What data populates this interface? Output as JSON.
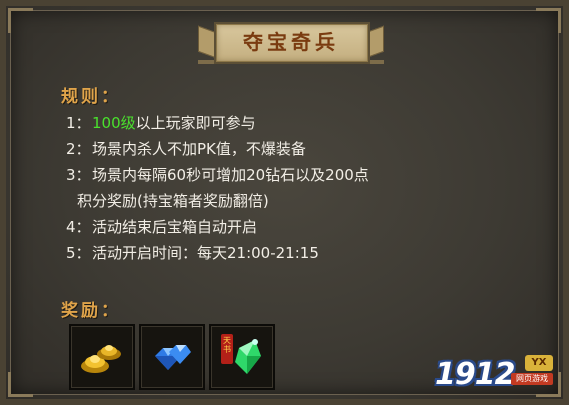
{
  "banner": {
    "title": "夺宝奇兵"
  },
  "rules_section": {
    "heading": "规则：",
    "items": [
      {
        "num": "1：",
        "highlight": "100级",
        "text": "以上玩家即可参与"
      },
      {
        "num": "2：",
        "text": "场景内杀人不加PK值，不爆装备"
      },
      {
        "num": "3：",
        "text": "场景内每隔60秒可增加20钻石以及200点"
      },
      {
        "continuation": "积分奖励(持宝箱者奖励翻倍)"
      },
      {
        "num": "4：",
        "text": "活动结束后宝箱自动开启"
      },
      {
        "num": "5：",
        "text": "活动开启时间：每天21:00-21:15"
      }
    ]
  },
  "rewards_section": {
    "heading": "奖励：",
    "items": [
      {
        "icon": "gold-ingot-icon"
      },
      {
        "icon": "blue-diamond-icon"
      },
      {
        "icon": "green-gem-scroll-icon",
        "tag": "天书"
      }
    ]
  },
  "brand": {
    "number": "1912",
    "yx": "YX",
    "sub": "网页游戏"
  },
  "colors": {
    "heading": "#e0a44a",
    "text": "#f2eee6",
    "highlight": "#4ae12d",
    "title": "#7a3b10"
  }
}
